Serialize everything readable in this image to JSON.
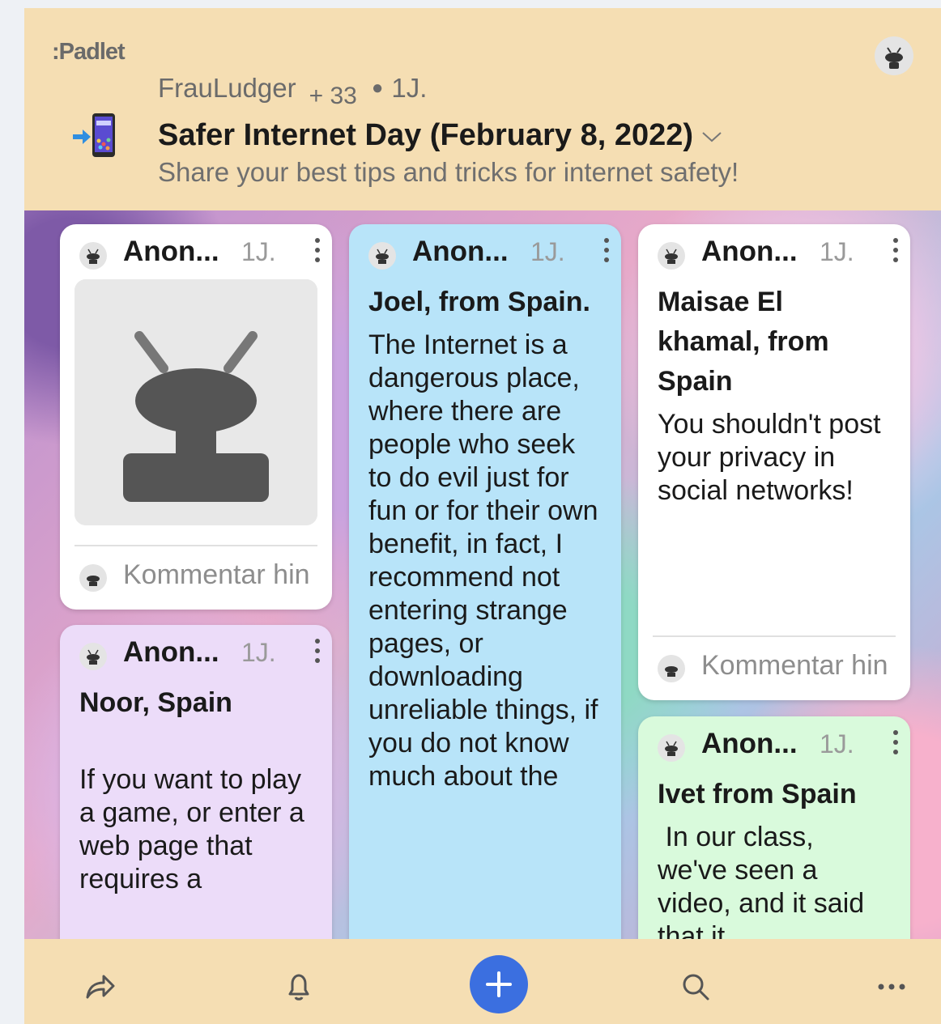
{
  "header": {
    "logo": ":Padlet",
    "author": "FrauLudger",
    "contributors": "+ 33",
    "age": "1J.",
    "title": "Safer Internet Day (February 8, 2022)",
    "subtitle": "Share your best tips and tricks for internet safety!"
  },
  "posts": {
    "p1": {
      "author": "Anon...",
      "time": "1J.",
      "comment_placeholder": "Kommentar hin"
    },
    "p2": {
      "author": "Anon...",
      "time": "1J.",
      "title": "Noor, Spain",
      "body": "If you want to play a game, or enter a web page that requires a"
    },
    "p3": {
      "author": "Anon...",
      "time": "1J.",
      "title": "Joel, from Spain.",
      "body": "The Internet is a dangerous place, where there are people who seek to do evil just for fun or for their own benefit, in fact, I recommend not entering strange pages, or downloading unreliable things, if you do not know much about the"
    },
    "p4": {
      "author": "Anon...",
      "time": "1J.",
      "title": "Maisae El khamal, from Spain",
      "body": "You shouldn't post your privacy in social networks!",
      "comment_placeholder": "Kommentar hin"
    },
    "p5": {
      "author": "Anon...",
      "time": "1J.",
      "title": "Ivet from Spain",
      "body": " In our class, we've seen a video, and it said that it"
    }
  },
  "colors": {
    "header_bg": "#f5deb3",
    "card_white": "#ffffff",
    "card_lilac": "#ecdcf9",
    "card_blue": "#b8e4f9",
    "card_green": "#d9fadc",
    "accent": "#3b6fe0"
  },
  "icons": {
    "share": "share-icon",
    "notifications": "bell-icon",
    "add": "plus-icon",
    "search": "search-icon",
    "more": "more-icon"
  }
}
